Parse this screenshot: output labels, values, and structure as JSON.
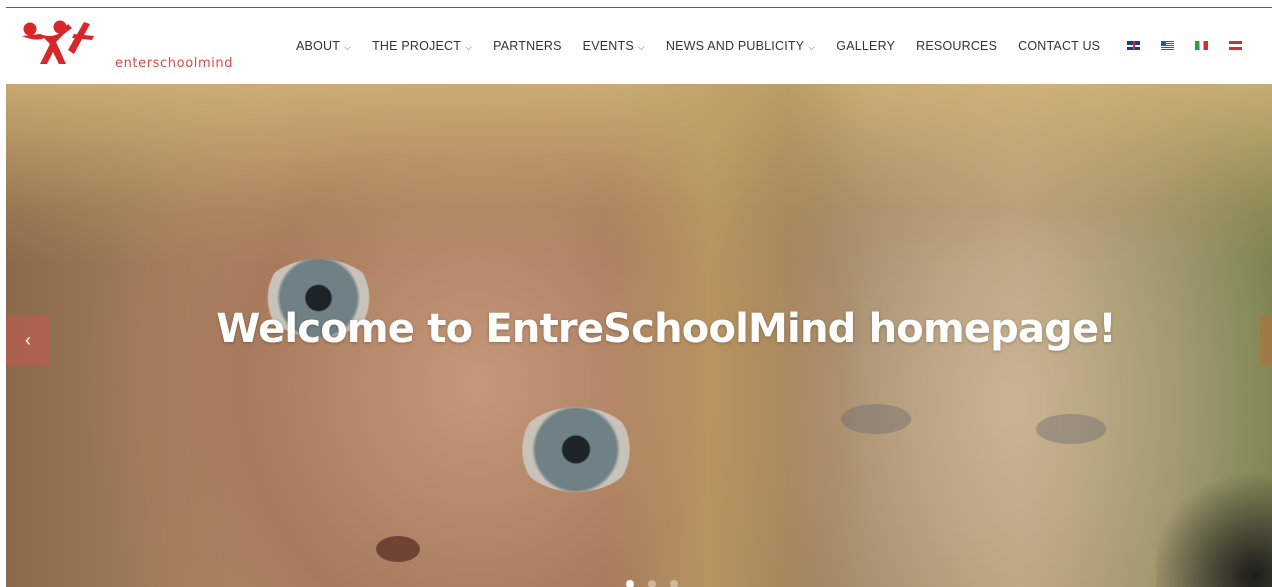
{
  "brand": {
    "name": "enterschoolmind",
    "accent": "#d9262a"
  },
  "nav": {
    "items": [
      {
        "label": "ABOUT",
        "has_dropdown": true
      },
      {
        "label": "THE PROJECT",
        "has_dropdown": true
      },
      {
        "label": "PARTNERS",
        "has_dropdown": false
      },
      {
        "label": "EVENTS",
        "has_dropdown": true
      },
      {
        "label": "NEWS AND PUBLICITY",
        "has_dropdown": true
      },
      {
        "label": "GALLERY",
        "has_dropdown": false
      },
      {
        "label": "RESOURCES",
        "has_dropdown": false
      },
      {
        "label": "CONTACT US",
        "has_dropdown": false
      }
    ],
    "chevron": "⌵",
    "languages": [
      "english-flag-icon",
      "greek-flag-icon",
      "italian-flag-icon",
      "austrian-flag-icon"
    ]
  },
  "hero": {
    "title": "Welcome to EntreSchoolMind homepage!",
    "prev_icon": "‹",
    "slides": 3,
    "active_slide": 1
  }
}
